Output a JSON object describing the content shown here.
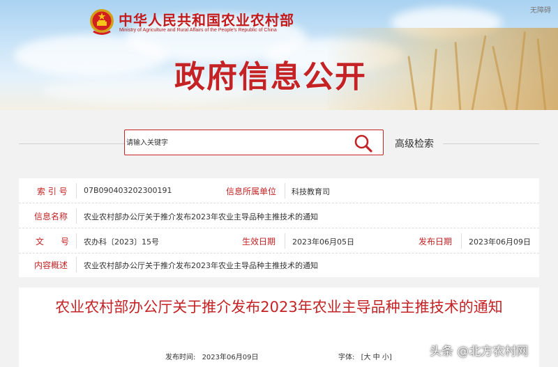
{
  "header": {
    "ministry_name_cn": "中华人民共和国农业农村部",
    "ministry_name_en": "Ministry of Agriculture and Rural Affairs of the People's Republic of China",
    "accessibility_link": "无障碍",
    "banner_title": "政府信息公开",
    "emblem_icon": "national-emblem-icon"
  },
  "search": {
    "placeholder": "请输入关键字",
    "search_icon": "search-icon",
    "advanced_label": "高级检索"
  },
  "info": {
    "index_label": "索 引 号",
    "index_value": "07B090403202300191",
    "owner_label": "信息所属单位",
    "owner_value": "科技教育司",
    "name_label": "信息名称",
    "name_value": "农业农村部办公厅关于推介发布2023年农业主导品种主推技术的通知",
    "doc_no_label": "文　　号",
    "doc_no_value": "农办科〔2023〕15号",
    "effective_label": "生效日期",
    "effective_value": "2023年06月05日",
    "publish_label": "发布日期",
    "publish_value": "2023年06月09日",
    "summary_label": "内容概述",
    "summary_value": "农业农村部办公厅关于推介发布2023年农业主导品种主推技术的通知"
  },
  "article": {
    "title": "农业农村部办公厅关于推介发布2023年农业主导品种主推技术的通知",
    "publish_time_label": "发布时间:",
    "publish_time_value": "2023年06月09日",
    "font_label": "字体:",
    "font_open": "[",
    "font_large": "大",
    "font_medium": "中",
    "font_small": "小",
    "font_close": "]"
  },
  "watermark": "头条 @北方农村网",
  "colors": {
    "accent_red": "#c42224",
    "banner_sky": "#a9d2f1",
    "page_bg": "#f2f2f2"
  }
}
